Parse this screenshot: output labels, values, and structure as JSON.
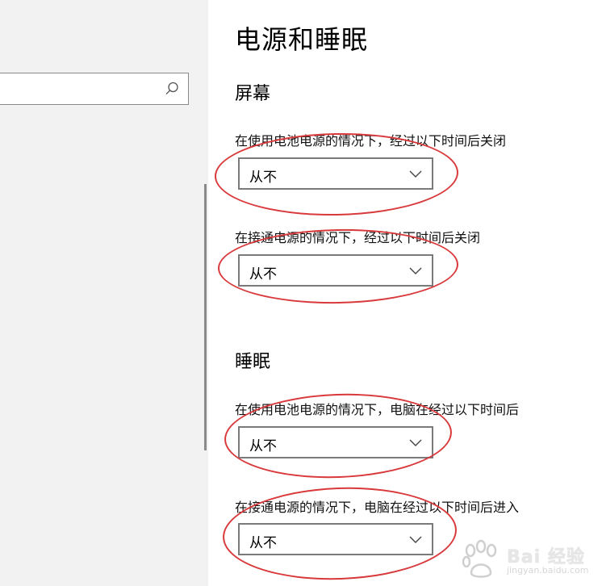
{
  "page": {
    "title": "电源和睡眠"
  },
  "search": {
    "placeholder": ""
  },
  "screen": {
    "heading": "屏幕",
    "battery_label": "在使用电池电源的情况下，经过以下时间后关闭",
    "battery_value": "从不",
    "plugged_label": "在接通电源的情况下，经过以下时间后关闭",
    "plugged_value": "从不"
  },
  "sleep": {
    "heading": "睡眠",
    "battery_label": "在使用电池电源的情况下，电脑在经过以下时间后",
    "battery_value": "从不",
    "plugged_label": "在接通电源的情况下，电脑在经过以下时间后进入",
    "plugged_value": "从不"
  },
  "watermark": {
    "brand": "Bai 经验",
    "url": "jingyan.baidu.com"
  },
  "colors": {
    "annotation": "#d9393b",
    "dropdown_border": "#7a7a7a",
    "sidebar": "#f2f2f2"
  }
}
